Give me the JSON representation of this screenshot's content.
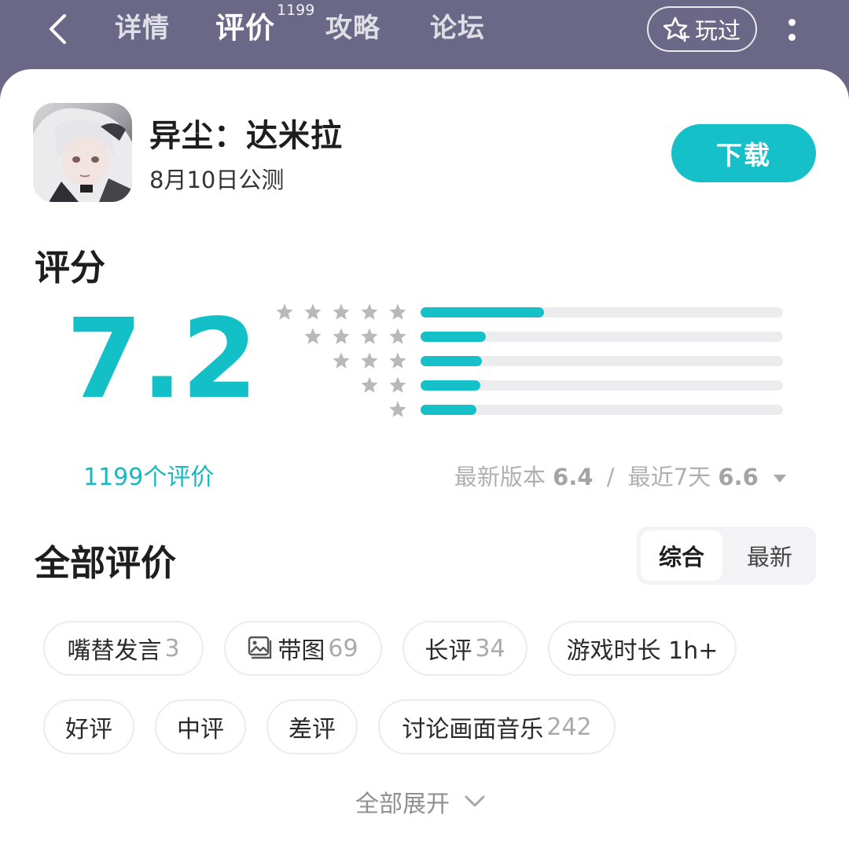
{
  "nav": {
    "tabs": [
      {
        "label": "详情"
      },
      {
        "label": "评价",
        "badge": "1199",
        "active": true
      },
      {
        "label": "攻略"
      },
      {
        "label": "论坛"
      }
    ],
    "played_label": "玩过"
  },
  "game": {
    "title": "异尘：达米拉",
    "subtitle": "8月10日公测",
    "download_label": "下载"
  },
  "rating": {
    "heading": "评分",
    "score": "7.2",
    "review_count": "1199个评价",
    "distribution": [
      {
        "stars": 5,
        "fraction": 0.34
      },
      {
        "stars": 4,
        "fraction": 0.18
      },
      {
        "stars": 3,
        "fraction": 0.17
      },
      {
        "stars": 2,
        "fraction": 0.165
      },
      {
        "stars": 1,
        "fraction": 0.155
      }
    ],
    "latest_version_label": "最新版本",
    "latest_version_score": "6.4",
    "separator": "/",
    "recent_label": "最近7天",
    "recent_score": "6.6"
  },
  "reviews": {
    "heading": "全部评价",
    "sort_options": [
      "综合",
      "最新"
    ],
    "filters": [
      {
        "label": "嘴替发言",
        "count": "3"
      },
      {
        "label": "带图",
        "count": "69",
        "icon": "image-icon"
      },
      {
        "label": "长评",
        "count": "34"
      },
      {
        "label": "游戏时长 1h+",
        "count": ""
      },
      {
        "label": "好评",
        "count": ""
      },
      {
        "label": "中评",
        "count": ""
      },
      {
        "label": "差评",
        "count": ""
      },
      {
        "label": "讨论画面音乐",
        "count": "242"
      }
    ],
    "expand_label": "全部展开"
  },
  "colors": {
    "accent": "#16c0c8",
    "header_bg": "#6b6887"
  }
}
